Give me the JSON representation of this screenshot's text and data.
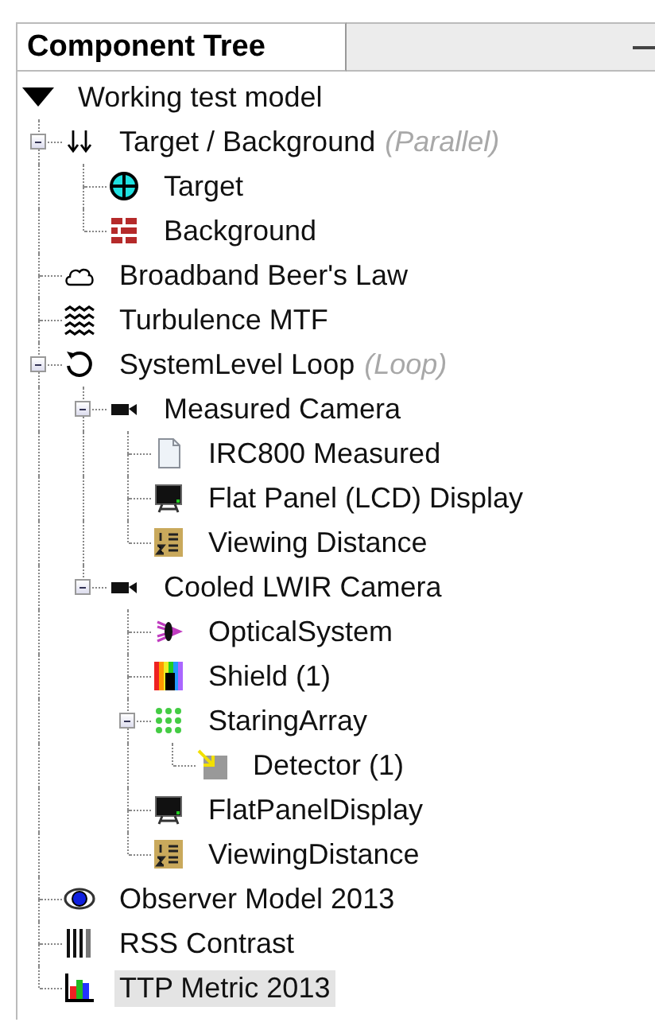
{
  "panel": {
    "title": "Component Tree"
  },
  "tree": {
    "label": "Working test model",
    "expanded": true,
    "selected": false,
    "children": [
      {
        "kind": "parallel",
        "label": "Target / Background",
        "note": "(Parallel)",
        "expanded": true,
        "selected": false,
        "children": [
          {
            "kind": "target",
            "label": "Target",
            "selected": false
          },
          {
            "kind": "bricks",
            "label": "Background",
            "selected": false
          }
        ]
      },
      {
        "kind": "cloud",
        "label": "Broadband Beer's Law",
        "selected": false
      },
      {
        "kind": "waves",
        "label": "Turbulence MTF",
        "selected": false
      },
      {
        "kind": "loop",
        "label": "SystemLevel Loop",
        "note": "(Loop)",
        "expanded": true,
        "selected": false,
        "children": [
          {
            "kind": "camera",
            "label": "Measured Camera",
            "expanded": true,
            "selected": false,
            "children": [
              {
                "kind": "document",
                "label": "IRC800 Measured",
                "selected": false
              },
              {
                "kind": "monitor",
                "label": "Flat Panel (LCD) Display",
                "selected": false
              },
              {
                "kind": "list",
                "label": "Viewing Distance",
                "selected": false
              }
            ]
          },
          {
            "kind": "camera",
            "label": "Cooled LWIR Camera",
            "expanded": true,
            "selected": false,
            "children": [
              {
                "kind": "optics",
                "label": "OpticalSystem",
                "selected": false
              },
              {
                "kind": "spectrum",
                "label": "Shield (1)",
                "selected": false
              },
              {
                "kind": "grid",
                "label": "StaringArray",
                "expanded": true,
                "selected": false,
                "children": [
                  {
                    "kind": "detector",
                    "label": "Detector (1)",
                    "selected": false
                  }
                ]
              },
              {
                "kind": "monitor",
                "label": "FlatPanelDisplay",
                "selected": false
              },
              {
                "kind": "list",
                "label": "ViewingDistance",
                "selected": false
              }
            ]
          }
        ]
      },
      {
        "kind": "eye",
        "label": "Observer Model 2013",
        "selected": false
      },
      {
        "kind": "bars",
        "label": "RSS Contrast",
        "selected": false
      },
      {
        "kind": "chart",
        "label": "TTP Metric 2013",
        "selected": true
      }
    ]
  }
}
